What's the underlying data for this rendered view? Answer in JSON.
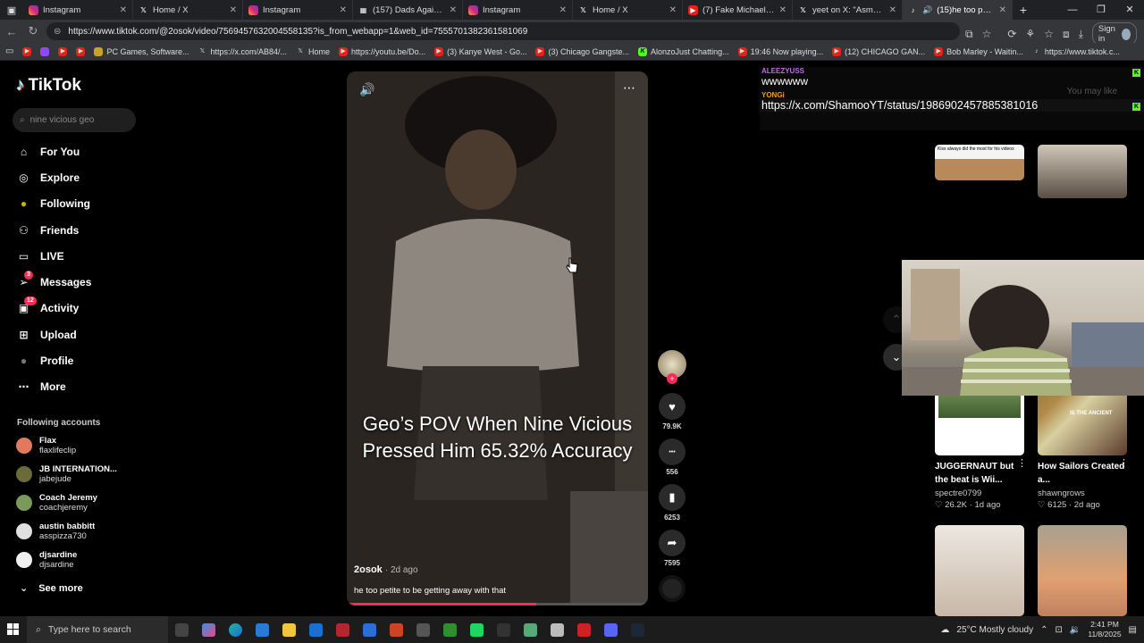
{
  "browser": {
    "tabs": [
      {
        "title": "Instagram",
        "icon": "instagram"
      },
      {
        "title": "Home / X",
        "icon": "x"
      },
      {
        "title": "Instagram",
        "icon": "instagram"
      },
      {
        "title": "(157) Dads Against Pre",
        "icon": "grid"
      },
      {
        "title": "Instagram",
        "icon": "instagram"
      },
      {
        "title": "Home / X",
        "icon": "x"
      },
      {
        "title": "(7) Fake Michael Jackso",
        "icon": "youtube"
      },
      {
        "title": "yeet on X: \"Asmongold",
        "icon": "x"
      },
      {
        "title": "(15)he too petite",
        "icon": "tiktok"
      }
    ],
    "url": "https://www.tiktok.com/@2osok/video/7569457632004558135?is_from_webapp=1&web_id=7555701382361581069",
    "sign_in": "Sign in",
    "bookmarks": [
      {
        "label": "",
        "icon": "youtube"
      },
      {
        "label": "",
        "icon": "twitch"
      },
      {
        "label": "",
        "icon": "youtube"
      },
      {
        "label": "",
        "icon": "youtube"
      },
      {
        "label": "PC Games, Software...",
        "icon": "game"
      },
      {
        "label": "https://x.com/AB84/...",
        "icon": "x"
      },
      {
        "label": "Home",
        "icon": "x"
      },
      {
        "label": "https://youtu.be/Do...",
        "icon": "youtube"
      },
      {
        "label": "(3) Kanye West - Go...",
        "icon": "youtube"
      },
      {
        "label": "(3) Chicago Gangste...",
        "icon": "youtube"
      },
      {
        "label": "AlonzoJust Chatting...",
        "icon": "kick"
      },
      {
        "label": "19:46 Now playing...",
        "icon": "youtube"
      },
      {
        "label": "(12) CHICAGO GAN...",
        "icon": "youtube"
      },
      {
        "label": "Bob Marley - Waitin...",
        "icon": "youtube"
      },
      {
        "label": "https://www.tiktok.c...",
        "icon": "tiktok"
      }
    ]
  },
  "tiktok": {
    "logo": "TikTok",
    "search_placeholder": "nine vicious geo",
    "menu": [
      {
        "label": "For You",
        "icon": "home-icon",
        "badge": ""
      },
      {
        "label": "Explore",
        "icon": "compass-icon",
        "badge": ""
      },
      {
        "label": "Following",
        "icon": "following-icon",
        "badge": ""
      },
      {
        "label": "Friends",
        "icon": "friends-icon",
        "badge": ""
      },
      {
        "label": "LIVE",
        "icon": "live-icon",
        "badge": ""
      },
      {
        "label": "Messages",
        "icon": "messages-icon",
        "badge": "3"
      },
      {
        "label": "Activity",
        "icon": "activity-icon",
        "badge": "12"
      },
      {
        "label": "Upload",
        "icon": "upload-icon",
        "badge": ""
      },
      {
        "label": "Profile",
        "icon": "profile-icon",
        "badge": ""
      },
      {
        "label": "More",
        "icon": "more-icon",
        "badge": ""
      }
    ],
    "following_title": "Following accounts",
    "following": [
      {
        "name": "Flax",
        "handle": "flaxlifeclip"
      },
      {
        "name": "JB INTERNATION...",
        "handle": "jabejude"
      },
      {
        "name": "Coach Jeremy",
        "handle": "coachjeremy"
      },
      {
        "name": "austin babbitt",
        "handle": "asspizza730"
      },
      {
        "name": "djsardine",
        "handle": "djsardine"
      }
    ],
    "see_more": "See more",
    "video": {
      "overlay_text": "Geo’s POV When Nine Vicious Pressed Him 65.32% Accuracy",
      "author": "2osok",
      "age": "· 2d ago",
      "caption": "he too petite to be getting away with that",
      "progress": 0.63
    },
    "actions": [
      {
        "icon": "heart-icon",
        "count": "79.9K"
      },
      {
        "icon": "comment-icon",
        "count": "556"
      },
      {
        "icon": "bookmark-icon",
        "count": "6253"
      },
      {
        "icon": "share-icon",
        "count": "7595"
      }
    ],
    "recommendations": [
      {
        "title": "JUGGERNAUT but the beat is Wii...",
        "author": "spectre0799",
        "likes": "26.2K",
        "age": "1d ago"
      },
      {
        "title": "How Sailors Created a...",
        "author": "shawngrows",
        "likes": "6125",
        "age": "2d ago"
      }
    ],
    "rec_thumb_text": "IS THE ANCIENT",
    "rec_thumb_caption": "Kiss always did the most for his videos"
  },
  "chat": [
    {
      "user": "ALEEZYUSS",
      "message": "wwwwww"
    },
    {
      "user": "YONGi",
      "message": "https://x.com/ShamooYT/status/1986902457885381016"
    }
  ],
  "chat_bg_hint": "You may like",
  "taskbar": {
    "search_placeholder": "Type here to search",
    "weather": "25°C  Mostly cloudy",
    "time": "2:41 PM",
    "date": "11/8/2025"
  }
}
